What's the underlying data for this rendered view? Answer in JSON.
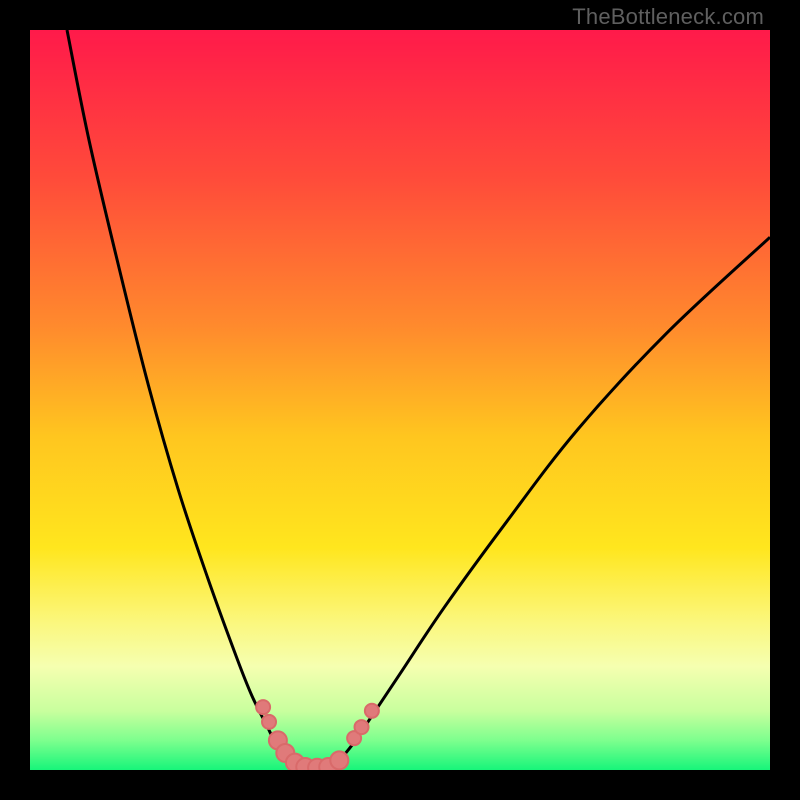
{
  "watermark": {
    "text": "TheBottleneck.com"
  },
  "gradient": {
    "stops": [
      {
        "offset": 0.0,
        "color": "#ff1a4a"
      },
      {
        "offset": 0.2,
        "color": "#ff4b3a"
      },
      {
        "offset": 0.4,
        "color": "#ff8a2d"
      },
      {
        "offset": 0.55,
        "color": "#ffc61f"
      },
      {
        "offset": 0.7,
        "color": "#ffe61e"
      },
      {
        "offset": 0.8,
        "color": "#fbf77d"
      },
      {
        "offset": 0.86,
        "color": "#f5ffb0"
      },
      {
        "offset": 0.92,
        "color": "#c9ff9e"
      },
      {
        "offset": 0.96,
        "color": "#7dff8e"
      },
      {
        "offset": 1.0,
        "color": "#17f57a"
      }
    ]
  },
  "curve": {
    "color": "#000000",
    "width": 3,
    "dots": {
      "color": "#e07a7a",
      "radius_small": 7,
      "radius_large": 9,
      "stroke": "#d96a6a",
      "stroke_width": 2
    }
  },
  "chart_data": {
    "type": "line",
    "title": "",
    "xlabel": "",
    "ylabel": "",
    "xlim": [
      0,
      100
    ],
    "ylim": [
      0,
      100
    ],
    "series": [
      {
        "name": "left-branch",
        "x": [
          5,
          8,
          12,
          16,
          20,
          24,
          28,
          30,
          32,
          33,
          34,
          35,
          36
        ],
        "y": [
          100,
          85,
          68,
          52,
          38,
          26,
          15,
          10,
          6,
          4,
          2.5,
          1.2,
          0.5
        ]
      },
      {
        "name": "right-branch",
        "x": [
          41,
          42,
          44,
          46,
          50,
          56,
          64,
          74,
          86,
          100
        ],
        "y": [
          0.5,
          1.5,
          4,
          7,
          13,
          22,
          33,
          46,
          59,
          72
        ]
      },
      {
        "name": "valley-floor",
        "x": [
          36,
          37,
          38,
          39,
          40,
          41
        ],
        "y": [
          0.5,
          0.2,
          0.1,
          0.1,
          0.2,
          0.5
        ]
      }
    ],
    "markers": [
      {
        "x": 31.5,
        "y": 8.5,
        "size": "small"
      },
      {
        "x": 32.3,
        "y": 6.5,
        "size": "small"
      },
      {
        "x": 33.5,
        "y": 4.0,
        "size": "large"
      },
      {
        "x": 34.5,
        "y": 2.3,
        "size": "large"
      },
      {
        "x": 35.8,
        "y": 1.0,
        "size": "large"
      },
      {
        "x": 37.2,
        "y": 0.4,
        "size": "large"
      },
      {
        "x": 38.8,
        "y": 0.3,
        "size": "large"
      },
      {
        "x": 40.3,
        "y": 0.4,
        "size": "large"
      },
      {
        "x": 41.8,
        "y": 1.3,
        "size": "large"
      },
      {
        "x": 43.8,
        "y": 4.3,
        "size": "small"
      },
      {
        "x": 44.8,
        "y": 5.8,
        "size": "small"
      },
      {
        "x": 46.2,
        "y": 8.0,
        "size": "small"
      }
    ]
  }
}
